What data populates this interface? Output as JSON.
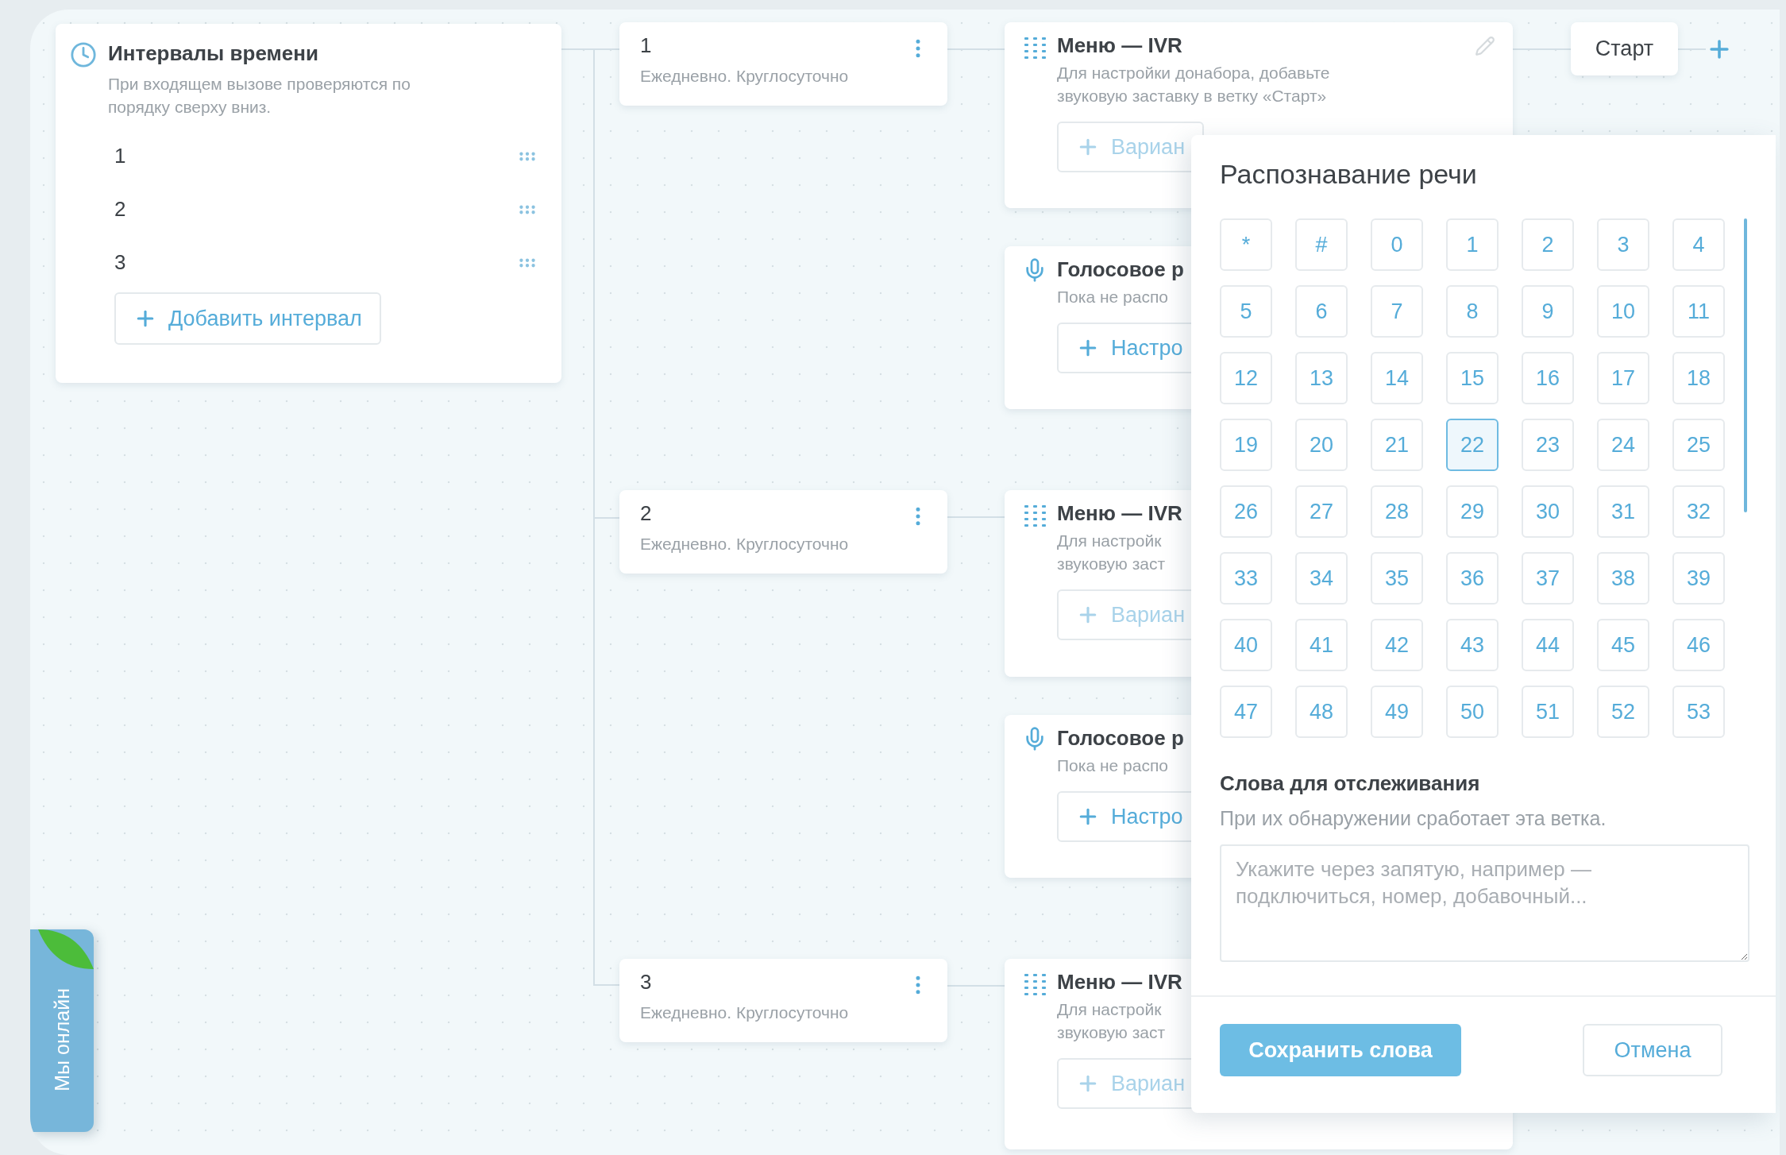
{
  "intervals_panel": {
    "title": "Интервалы времени",
    "description": "При входящем вызове проверяются по порядку сверху вниз.",
    "items": [
      {
        "label": "1"
      },
      {
        "label": "2"
      },
      {
        "label": "3"
      }
    ],
    "add_button": "Добавить интервал"
  },
  "interval_nodes": [
    {
      "title": "1",
      "schedule": "Ежедневно. Круглосуточно"
    },
    {
      "title": "2",
      "schedule": "Ежедневно. Круглосуточно"
    },
    {
      "title": "3",
      "schedule": "Ежедневно. Круглосуточно"
    }
  ],
  "action_nodes": [
    {
      "kind": "menu",
      "title": "Меню — IVR",
      "description_lines": [
        "Для настройки донабора, добавьте",
        "звуковую заставку в ветку «Старт»"
      ],
      "button": "Вариан",
      "edit_icon": true
    },
    {
      "kind": "voice",
      "title": "Голосовое р",
      "description_lines": [
        "Пока не распо"
      ],
      "button": "Настро",
      "edit_icon": false
    },
    {
      "kind": "menu",
      "title": "Меню — IVR",
      "description_lines": [
        "Для настройк",
        "звуковую заст"
      ],
      "button": "Вариан",
      "edit_icon": false
    },
    {
      "kind": "voice",
      "title": "Голосовое р",
      "description_lines": [
        "Пока не распо"
      ],
      "button": "Настро",
      "edit_icon": false
    },
    {
      "kind": "menu",
      "title": "Меню — IVR",
      "description_lines": [
        "Для настройк",
        "звуковую заст"
      ],
      "button": "Вариан",
      "edit_icon": false
    }
  ],
  "start_node": {
    "label": "Старт"
  },
  "speech_popup": {
    "title": "Распознавание речи",
    "keys": [
      {
        "label": "*",
        "selected": false
      },
      {
        "label": "#",
        "selected": false
      },
      {
        "label": "0",
        "selected": false
      },
      {
        "label": "1",
        "selected": false
      },
      {
        "label": "2",
        "selected": false
      },
      {
        "label": "3",
        "selected": false
      },
      {
        "label": "4",
        "selected": false
      },
      {
        "label": "5",
        "selected": false
      },
      {
        "label": "6",
        "selected": false
      },
      {
        "label": "7",
        "selected": false
      },
      {
        "label": "8",
        "selected": false
      },
      {
        "label": "9",
        "selected": false
      },
      {
        "label": "10",
        "selected": false
      },
      {
        "label": "11",
        "selected": false
      },
      {
        "label": "12",
        "selected": false
      },
      {
        "label": "13",
        "selected": false
      },
      {
        "label": "14",
        "selected": false
      },
      {
        "label": "15",
        "selected": false
      },
      {
        "label": "16",
        "selected": false
      },
      {
        "label": "17",
        "selected": false
      },
      {
        "label": "18",
        "selected": false
      },
      {
        "label": "19",
        "selected": false
      },
      {
        "label": "20",
        "selected": false
      },
      {
        "label": "21",
        "selected": false
      },
      {
        "label": "22",
        "selected": true
      },
      {
        "label": "23",
        "selected": false
      },
      {
        "label": "24",
        "selected": false
      },
      {
        "label": "25",
        "selected": false
      },
      {
        "label": "26",
        "selected": false
      },
      {
        "label": "27",
        "selected": false
      },
      {
        "label": "28",
        "selected": false
      },
      {
        "label": "29",
        "selected": false
      },
      {
        "label": "30",
        "selected": false
      },
      {
        "label": "31",
        "selected": false
      },
      {
        "label": "32",
        "selected": false
      },
      {
        "label": "33",
        "selected": false
      },
      {
        "label": "34",
        "selected": false
      },
      {
        "label": "35",
        "selected": false
      },
      {
        "label": "36",
        "selected": false
      },
      {
        "label": "37",
        "selected": false
      },
      {
        "label": "38",
        "selected": false
      },
      {
        "label": "39",
        "selected": false
      },
      {
        "label": "40",
        "selected": false
      },
      {
        "label": "41",
        "selected": false
      },
      {
        "label": "42",
        "selected": false
      },
      {
        "label": "43",
        "selected": false
      },
      {
        "label": "44",
        "selected": false
      },
      {
        "label": "45",
        "selected": false
      },
      {
        "label": "46",
        "selected": false
      },
      {
        "label": "47",
        "selected": false
      },
      {
        "label": "48",
        "selected": false
      },
      {
        "label": "49",
        "selected": false
      },
      {
        "label": "50",
        "selected": false
      },
      {
        "label": "51",
        "selected": false
      },
      {
        "label": "52",
        "selected": false
      },
      {
        "label": "53",
        "selected": false
      }
    ],
    "words_title": "Слова для отслеживания",
    "words_hint": "При их обнаружении сработает эта ветка.",
    "words_field": {
      "placeholder": "Укажите через запятую, например — подключиться, номер, добавочный..."
    },
    "save_button": "Сохранить слова",
    "cancel_button": "Отмена"
  },
  "chat_tab": {
    "label": "Мы онлайн"
  }
}
